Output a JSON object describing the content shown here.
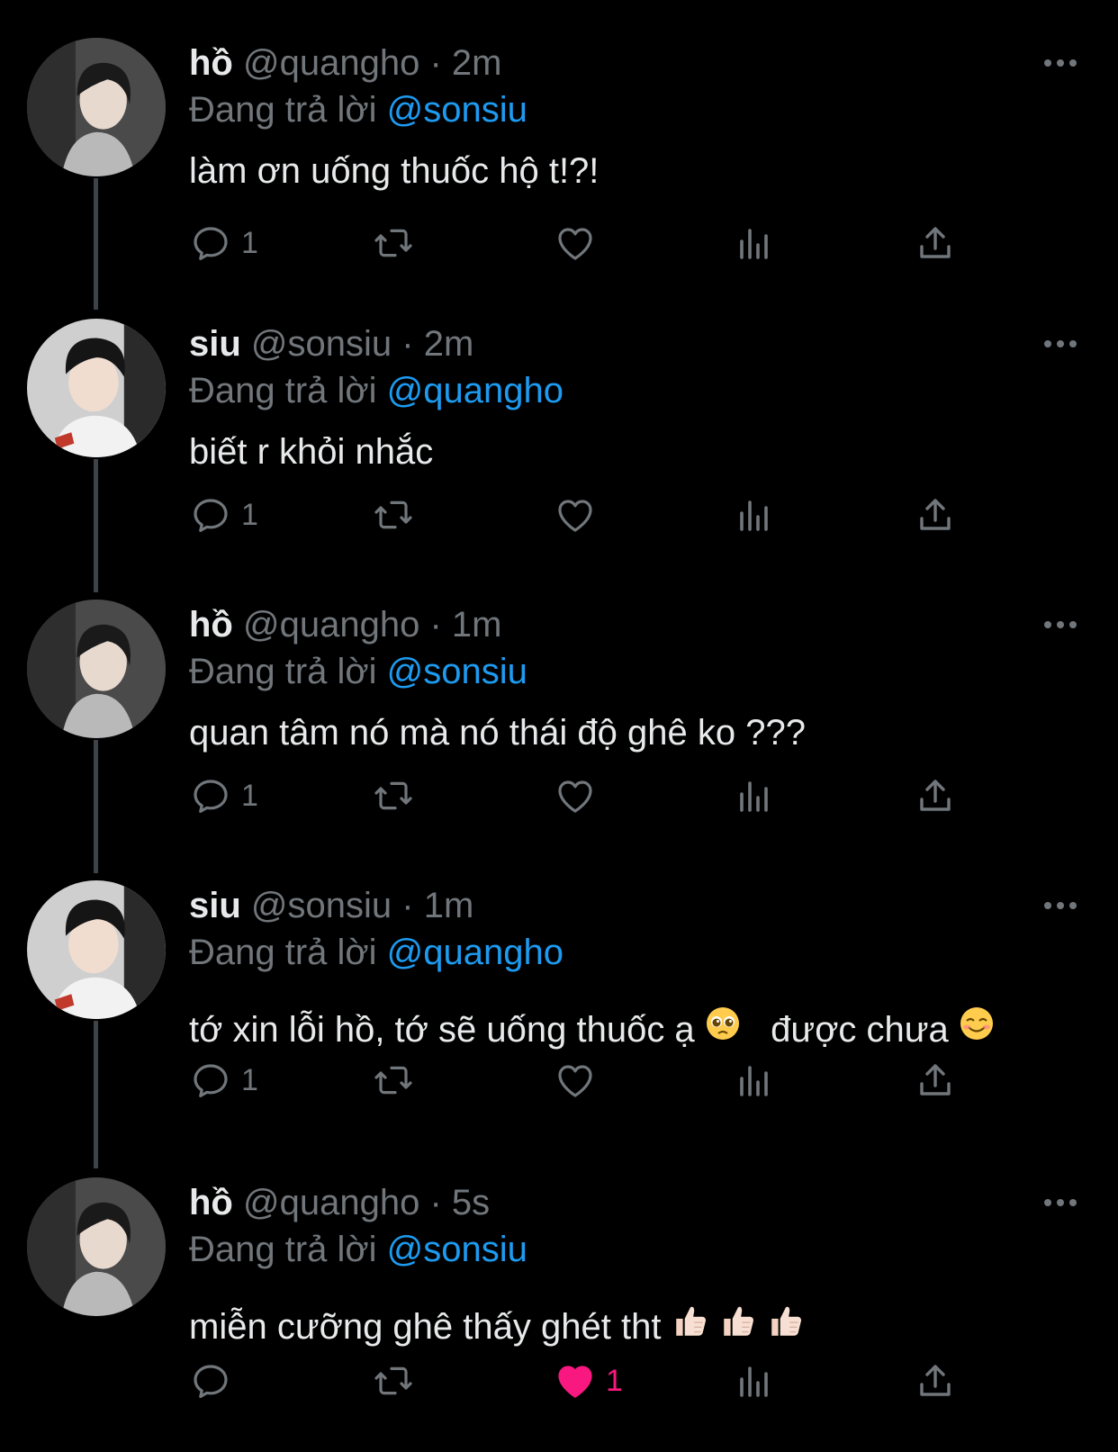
{
  "tweets": [
    {
      "name": "hồ",
      "handle": "@quangho",
      "time": "2m",
      "replying_label": "Đang trả lời",
      "replying_to": "@sonsiu",
      "text": "làm ơn uống thuốc hộ t!?!",
      "reply_count": "1",
      "like_count": "",
      "liked": false,
      "avatar": "quangho"
    },
    {
      "name": "siu",
      "handle": "@sonsiu",
      "time": "2m",
      "replying_label": "Đang trả lời",
      "replying_to": "@quangho",
      "text": "biết r khỏi nhắc",
      "reply_count": "1",
      "like_count": "",
      "liked": false,
      "avatar": "sonsiu"
    },
    {
      "name": "hồ",
      "handle": "@quangho",
      "time": "1m",
      "replying_label": "Đang trả lời",
      "replying_to": "@sonsiu",
      "text": "quan tâm nó mà nó thái độ ghê ko ???",
      "reply_count": "1",
      "like_count": "",
      "liked": false,
      "avatar": "quangho"
    },
    {
      "name": "siu",
      "handle": "@sonsiu",
      "time": "1m",
      "replying_label": "Đang trả lời",
      "replying_to": "@quangho",
      "text_parts": [
        "tớ xin lỗi hồ, tớ sẽ uống thuốc ạ",
        "  được chưa"
      ],
      "text_emojis": [
        "pleading-face",
        "smiling-face"
      ],
      "reply_count": "1",
      "like_count": "",
      "liked": false,
      "avatar": "sonsiu"
    },
    {
      "name": "hồ",
      "handle": "@quangho",
      "time": "5s",
      "replying_label": "Đang trả lời",
      "replying_to": "@sonsiu",
      "text": "miễn cưỡng ghê thấy ghét tht",
      "text_emojis": [
        "thumbs-up",
        "thumbs-up",
        "thumbs-up"
      ],
      "reply_count": "",
      "like_count": "1",
      "liked": true,
      "avatar": "quangho"
    }
  ],
  "colors": {
    "background": "#000000",
    "text": "#e7e9ea",
    "muted": "#71767b",
    "mention": "#1d9bf0",
    "like": "#f91880"
  }
}
